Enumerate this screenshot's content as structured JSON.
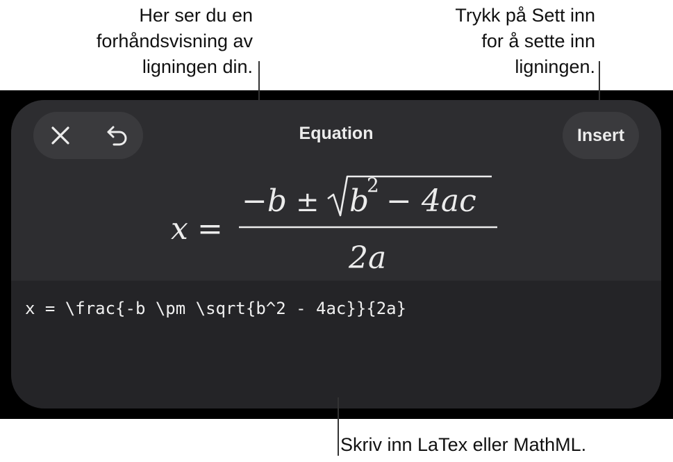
{
  "callouts": {
    "preview": [
      "Her ser du en",
      "forhåndsvisning av",
      "ligningen din."
    ],
    "insert": [
      "Trykk på Sett inn",
      "for å sette inn",
      "ligningen."
    ],
    "input": "Skriv inn LaTex eller MathML."
  },
  "toolbar": {
    "close_icon": "close-icon",
    "undo_icon": "undo-icon",
    "title": "Equation",
    "insert_label": "Insert"
  },
  "preview": {
    "lhs": "x",
    "equals": "=",
    "numerator_minus_b": "−b",
    "plus_minus": "±",
    "radicand_b": "b",
    "radicand_exp": "2",
    "radicand_rest": "− 4ac",
    "denominator": "2a"
  },
  "editor": {
    "latex": "x = \\frac{-b \\pm \\sqrt{b^2 - 4ac}}{2a}"
  },
  "colors": {
    "panel": "#242427",
    "preview_bg": "#2d2d30",
    "button_bg": "#3a3a3d",
    "text": "#ececec"
  }
}
